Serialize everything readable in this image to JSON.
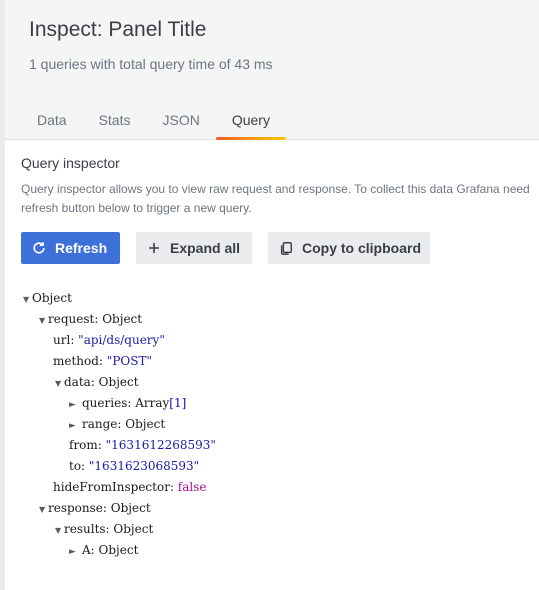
{
  "header": {
    "title": "Inspect: Panel Title",
    "subtitle": "1 queries with total query time of 43 ms"
  },
  "tabs": [
    {
      "label": "Data"
    },
    {
      "label": "Stats"
    },
    {
      "label": "JSON"
    },
    {
      "label": "Query"
    }
  ],
  "active_tab": "Query",
  "inspector": {
    "title": "Query inspector",
    "description": "Query inspector allows you to view raw request and response. To collect this data Grafana needs to issue a new query. Click refresh button below to trigger a new query.",
    "description_line1": "Query inspector allows you to view raw request and response. To collect this data Grafana need",
    "description_line2": "refresh button below to trigger a new query.",
    "refresh_label": "Refresh",
    "expand_label": "Expand all",
    "copy_label": "Copy to clipboard"
  },
  "tree": {
    "root": "Object",
    "request_key": "request",
    "request_val": "Object",
    "url_key": "url",
    "url_val": "\"api/ds/query\"",
    "method_key": "method",
    "method_val": "\"POST\"",
    "data_key": "data",
    "data_val": "Object",
    "queries_key": "queries",
    "queries_val": "Array",
    "queries_count": "[1]",
    "range_key": "range",
    "range_val": "Object",
    "from_key": "from",
    "from_val": "\"1631612268593\"",
    "to_key": "to",
    "to_val": "\"1631623068593\"",
    "hide_key": "hideFromInspector",
    "hide_val": "false",
    "response_key": "response",
    "response_val": "Object",
    "results_key": "results",
    "results_val": "Object",
    "a_key": "A",
    "a_val": "Object"
  },
  "colors": {
    "primary": "#3d71d9",
    "tab_accent_start": "#f05a28",
    "tab_accent_end": "#fbca0a",
    "boolean": "#aa0d91",
    "string": "#1a1aa6"
  }
}
